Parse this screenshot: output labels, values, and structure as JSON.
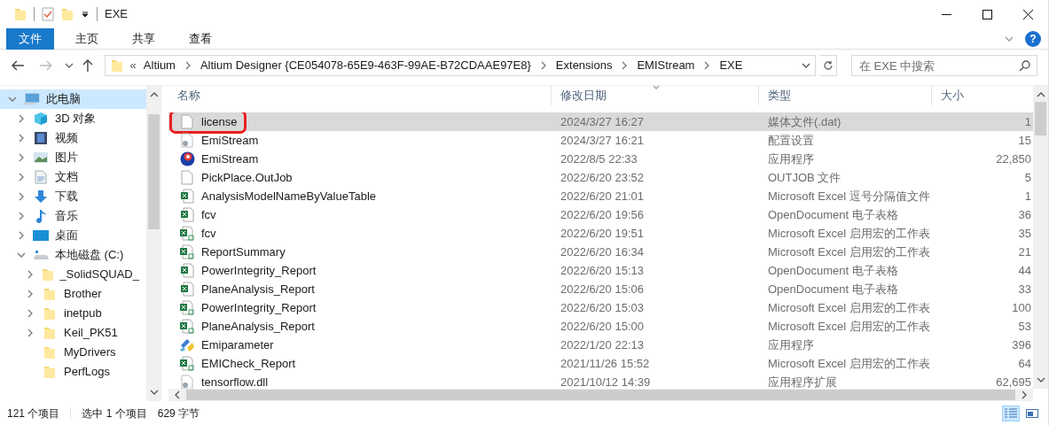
{
  "window": {
    "title": "EXE"
  },
  "ribbon": {
    "tabs": [
      {
        "label": "文件",
        "selected": true
      },
      {
        "label": "主页",
        "selected": false
      },
      {
        "label": "共享",
        "selected": false
      },
      {
        "label": "查看",
        "selected": false
      }
    ],
    "help": "?"
  },
  "address": {
    "overflow": "«",
    "crumbs": [
      "Altium",
      "Altium Designer {CE054078-65E9-463F-99AE-B72CDAAE97E8}",
      "Extensions",
      "EMIStream",
      "EXE"
    ]
  },
  "search": {
    "placeholder": "在 EXE 中搜索"
  },
  "sidebar": {
    "items": [
      {
        "label": "此电脑",
        "kind": "pc",
        "expanded": true,
        "selected": true,
        "children": [
          {
            "label": "3D 对象",
            "kind": "cube",
            "expanded": false,
            "selected": false
          },
          {
            "label": "视频",
            "kind": "video",
            "expanded": false,
            "selected": false
          },
          {
            "label": "图片",
            "kind": "image",
            "expanded": false,
            "selected": false
          },
          {
            "label": "文档",
            "kind": "doc",
            "expanded": false,
            "selected": false
          },
          {
            "label": "下载",
            "kind": "download",
            "expanded": false,
            "selected": false
          },
          {
            "label": "音乐",
            "kind": "music",
            "expanded": false,
            "selected": false
          },
          {
            "label": "桌面",
            "kind": "desktop",
            "expanded": false,
            "selected": false
          },
          {
            "label": "本地磁盘 (C:)",
            "kind": "drive",
            "expanded": true,
            "selected": false,
            "children": [
              {
                "label": "_SolidSQUAD_",
                "kind": "folder",
                "expanded": false,
                "selected": false
              },
              {
                "label": "Brother",
                "kind": "folder",
                "expanded": false,
                "selected": false
              },
              {
                "label": "inetpub",
                "kind": "folder",
                "expanded": false,
                "selected": false
              },
              {
                "label": "Keil_PK51",
                "kind": "folder",
                "expanded": false,
                "selected": false
              },
              {
                "label": "MyDrivers",
                "kind": "folder",
                "selected": false
              },
              {
                "label": "PerfLogs",
                "kind": "folder",
                "selected": false
              }
            ]
          }
        ]
      }
    ]
  },
  "table": {
    "columns": [
      "名称",
      "修改日期",
      "类型",
      "大小"
    ],
    "rows": [
      {
        "name": "license",
        "kind": "blank",
        "date": "2024/3/27 16:27",
        "type": "媒体文件(.dat)",
        "size": "1",
        "selected": true,
        "highlighted": true
      },
      {
        "name": "EmiStream",
        "kind": "config",
        "date": "2024/3/27 16:21",
        "type": "配置设置",
        "size": "15",
        "selected": false,
        "highlighted": false
      },
      {
        "name": "EmiStream",
        "kind": "app",
        "date": "2022/8/5 22:33",
        "type": "应用程序",
        "size": "22,850",
        "selected": false,
        "highlighted": false
      },
      {
        "name": "PickPlace.OutJob",
        "kind": "blank",
        "date": "2022/6/20 23:52",
        "type": "OUTJOB 文件",
        "size": "5",
        "selected": false,
        "highlighted": false
      },
      {
        "name": "AnalysisModelNameByValueTable",
        "kind": "excel",
        "date": "2022/6/20 21:01",
        "type": "Microsoft Excel 逗号分隔值文件",
        "size": "1",
        "selected": false,
        "highlighted": false
      },
      {
        "name": "fcv",
        "kind": "excel",
        "date": "2022/6/20 19:56",
        "type": "OpenDocument 电子表格",
        "size": "36",
        "selected": false,
        "highlighted": false
      },
      {
        "name": "fcv",
        "kind": "macro",
        "date": "2022/6/20 19:51",
        "type": "Microsoft Excel 启用宏的工作表",
        "size": "35",
        "selected": false,
        "highlighted": false
      },
      {
        "name": "ReportSummary",
        "kind": "macro",
        "date": "2022/6/20 16:34",
        "type": "Microsoft Excel 启用宏的工作表",
        "size": "21",
        "selected": false,
        "highlighted": false
      },
      {
        "name": "PowerIntegrity_Report",
        "kind": "excel",
        "date": "2022/6/20 15:13",
        "type": "OpenDocument 电子表格",
        "size": "44",
        "selected": false,
        "highlighted": false
      },
      {
        "name": "PlaneAnalysis_Report",
        "kind": "excel",
        "date": "2022/6/20 15:06",
        "type": "OpenDocument 电子表格",
        "size": "33",
        "selected": false,
        "highlighted": false
      },
      {
        "name": "PowerIntegrity_Report",
        "kind": "macro",
        "date": "2022/6/20 15:03",
        "type": "Microsoft Excel 启用宏的工作表",
        "size": "100",
        "selected": false,
        "highlighted": false
      },
      {
        "name": "PlaneAnalysis_Report",
        "kind": "macro",
        "date": "2022/6/20 15:00",
        "type": "Microsoft Excel 启用宏的工作表",
        "size": "53",
        "selected": false,
        "highlighted": false
      },
      {
        "name": "Emiparameter",
        "kind": "wizard",
        "date": "2022/1/20 22:13",
        "type": "应用程序",
        "size": "396",
        "selected": false,
        "highlighted": false
      },
      {
        "name": "EMICheck_Report",
        "kind": "macro",
        "date": "2021/11/26 15:52",
        "type": "Microsoft Excel 启用宏的工作表",
        "size": "64",
        "selected": false,
        "highlighted": false
      },
      {
        "name": "tensorflow.dll",
        "kind": "config",
        "date": "2021/10/12 14:39",
        "type": "应用程序扩展",
        "size": "62,695",
        "selected": false,
        "highlighted": false
      }
    ]
  },
  "status_bar": {
    "items": [
      "121 个项目",
      "选中 1 个项目",
      "629 字节"
    ],
    "views": [
      {
        "kind": "details",
        "selected": true
      },
      {
        "kind": "tiles",
        "selected": false
      }
    ]
  }
}
